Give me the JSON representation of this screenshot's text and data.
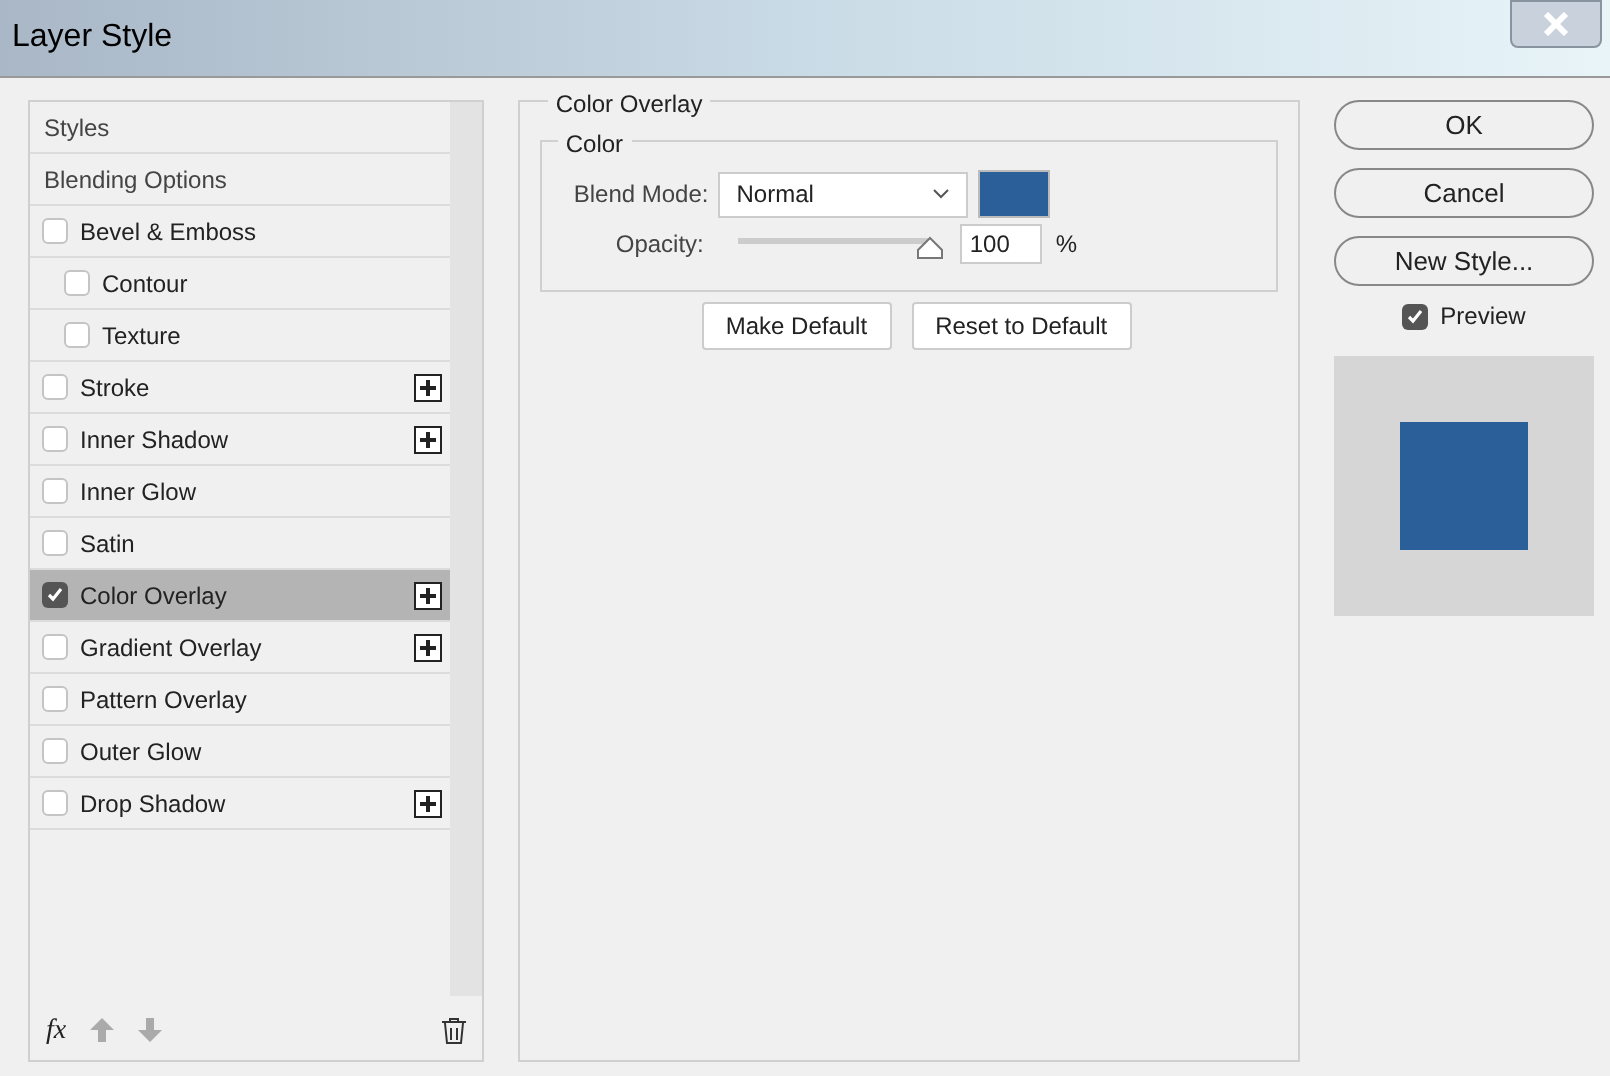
{
  "window": {
    "title": "Layer Style"
  },
  "sidebar": {
    "items": [
      {
        "kind": "header",
        "label": "Styles",
        "selected": false
      },
      {
        "kind": "header",
        "label": "Blending Options",
        "selected": false
      },
      {
        "kind": "effect",
        "label": "Bevel & Emboss",
        "checked": false,
        "selected": false,
        "addable": false,
        "children": [
          {
            "kind": "effect",
            "label": "Contour",
            "checked": false,
            "selected": false,
            "addable": false
          },
          {
            "kind": "effect",
            "label": "Texture",
            "checked": false,
            "selected": false,
            "addable": false
          }
        ]
      },
      {
        "kind": "effect",
        "label": "Stroke",
        "checked": false,
        "selected": false,
        "addable": true
      },
      {
        "kind": "effect",
        "label": "Inner Shadow",
        "checked": false,
        "selected": false,
        "addable": true
      },
      {
        "kind": "effect",
        "label": "Inner Glow",
        "checked": false,
        "selected": false,
        "addable": false
      },
      {
        "kind": "effect",
        "label": "Satin",
        "checked": false,
        "selected": false,
        "addable": false
      },
      {
        "kind": "effect",
        "label": "Color Overlay",
        "checked": true,
        "selected": true,
        "addable": true
      },
      {
        "kind": "effect",
        "label": "Gradient Overlay",
        "checked": false,
        "selected": false,
        "addable": true
      },
      {
        "kind": "effect",
        "label": "Pattern Overlay",
        "checked": false,
        "selected": false,
        "addable": false
      },
      {
        "kind": "effect",
        "label": "Outer Glow",
        "checked": false,
        "selected": false,
        "addable": false
      },
      {
        "kind": "effect",
        "label": "Drop Shadow",
        "checked": false,
        "selected": false,
        "addable": true
      }
    ],
    "fx_label": "fx"
  },
  "panel": {
    "title": "Color Overlay",
    "group_title": "Color",
    "blend_mode_label": "Blend Mode:",
    "blend_mode": "Normal",
    "color": "#2a5f9a",
    "opacity_label": "Opacity:",
    "opacity": {
      "level": 1.0
    },
    "opacity_value": "100",
    "opacity_unit": "%",
    "buttons": [
      "Make Default",
      "Reset to Default"
    ]
  },
  "actions": [
    "OK",
    "Cancel",
    "New Style..."
  ],
  "preview": {
    "label": "Preview",
    "checked": true
  }
}
